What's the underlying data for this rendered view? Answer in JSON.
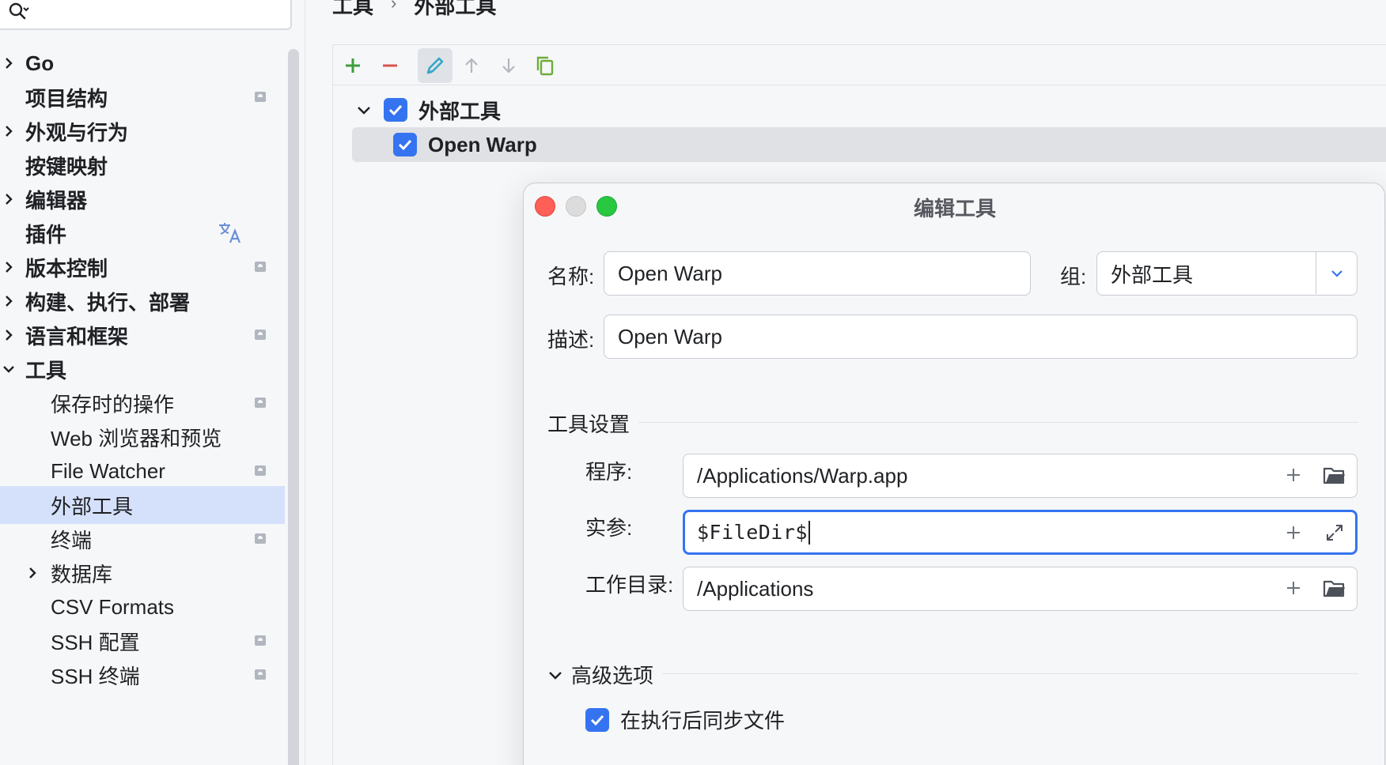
{
  "sidebar": {
    "search": {
      "placeholder": ""
    },
    "items": [
      {
        "label": "Go",
        "expandable": true,
        "expanded": false,
        "level": 0,
        "badge": false
      },
      {
        "label": "项目结构",
        "expandable": false,
        "level": 0,
        "badge": true
      },
      {
        "label": "外观与行为",
        "expandable": true,
        "expanded": false,
        "level": 0,
        "badge": false
      },
      {
        "label": "按键映射",
        "expandable": false,
        "level": 0,
        "badge": false
      },
      {
        "label": "编辑器",
        "expandable": true,
        "expanded": false,
        "level": 0,
        "badge": false
      },
      {
        "label": "插件",
        "expandable": false,
        "level": 0,
        "badge": false,
        "icon": "translate-icon"
      },
      {
        "label": "版本控制",
        "expandable": true,
        "expanded": false,
        "level": 0,
        "badge": true
      },
      {
        "label": "构建、执行、部署",
        "expandable": true,
        "expanded": false,
        "level": 0,
        "badge": false
      },
      {
        "label": "语言和框架",
        "expandable": true,
        "expanded": false,
        "level": 0,
        "badge": true
      },
      {
        "label": "工具",
        "expandable": true,
        "expanded": true,
        "level": 0,
        "badge": false
      },
      {
        "label": "保存时的操作",
        "expandable": false,
        "level": 1,
        "badge": true
      },
      {
        "label": "Web 浏览器和预览",
        "expandable": false,
        "level": 1,
        "badge": false
      },
      {
        "label": "File Watcher",
        "expandable": false,
        "level": 1,
        "badge": true
      },
      {
        "label": "外部工具",
        "expandable": false,
        "level": 1,
        "badge": false,
        "selected": true
      },
      {
        "label": "终端",
        "expandable": false,
        "level": 1,
        "badge": true
      },
      {
        "label": "数据库",
        "expandable": true,
        "expanded": false,
        "level": 1,
        "badge": false
      },
      {
        "label": "CSV Formats",
        "expandable": false,
        "level": 1,
        "badge": false
      },
      {
        "label": "SSH 配置",
        "expandable": false,
        "level": 1,
        "badge": true
      },
      {
        "label": "SSH 终端",
        "expandable": false,
        "level": 1,
        "badge": true
      }
    ]
  },
  "breadcrumb": {
    "parent": "工具",
    "current": "外部工具"
  },
  "toolbar": {
    "buttons": [
      "add-icon",
      "remove-icon",
      "edit-icon",
      "move-up-icon",
      "move-down-icon",
      "copy-icon"
    ],
    "colors": {
      "add": "#3d9d3d",
      "remove": "#d9534f",
      "edit": "#35a6c9",
      "disabled": "#b3b7be",
      "copy": "#6cac3a"
    }
  },
  "tree": {
    "group": {
      "label": "外部工具",
      "checked": true
    },
    "tools": [
      {
        "label": "Open Warp",
        "checked": true
      }
    ]
  },
  "dialog": {
    "title": "编辑工具",
    "name_label": "名称:",
    "name_value": "Open Warp",
    "group_label": "组:",
    "group_value": "外部工具",
    "description_label": "描述:",
    "description_value": "Open Warp",
    "tool_settings_title": "工具设置",
    "program_label": "程序:",
    "program_value": "/Applications/Warp.app",
    "arguments_label": "实参:",
    "arguments_value": "$FileDir$",
    "working_dir_label": "工作目录:",
    "working_dir_value": "/Applications",
    "advanced_title": "高级选项",
    "sync_files_label": "在执行后同步文件",
    "sync_files_checked": true
  },
  "colors": {
    "accent": "#3574f0",
    "selection": "#d5e1fb",
    "close": "#fe5f57",
    "maximize": "#28c840",
    "minimize": "#dcdcdc"
  }
}
